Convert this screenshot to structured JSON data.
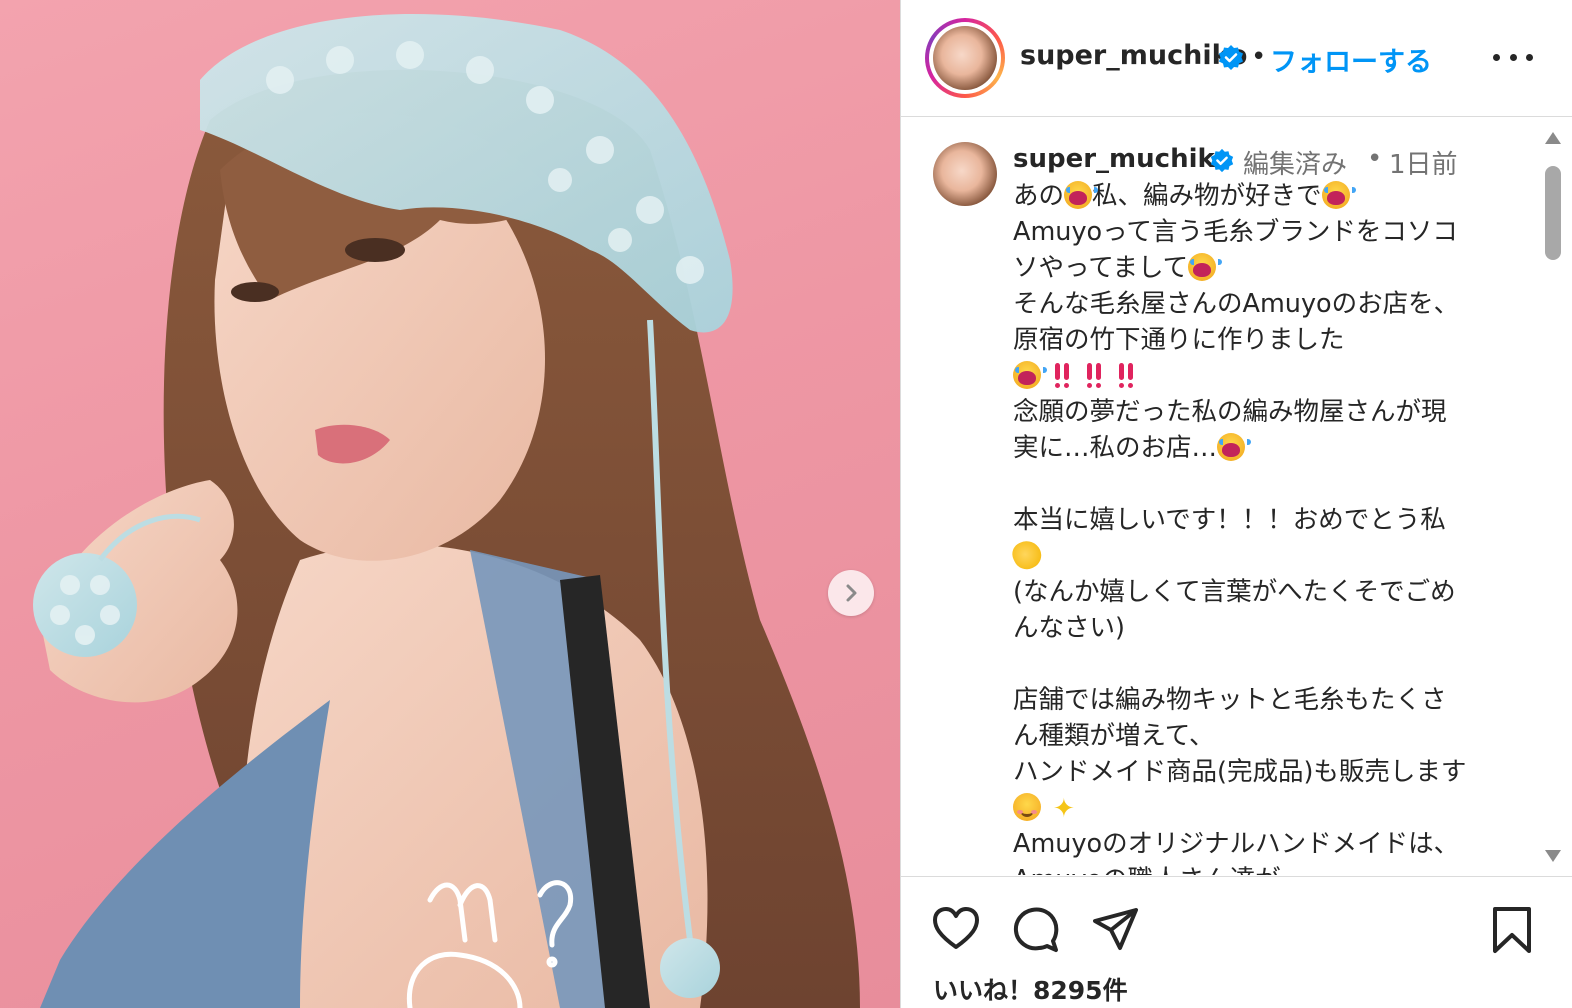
{
  "post": {
    "author": "super_muchiko",
    "follow_label": "フォローする",
    "header_separator": "•",
    "image_overlay_text": "m?"
  },
  "caption": {
    "author": "super_muchiko",
    "edited_label": "編集済み",
    "separator": "•",
    "time_ago": "1日前",
    "lines": [
      {
        "text": "あの",
        "e1": "cry",
        "t2": "私、編み物が好きで",
        "e2": "cry"
      },
      {
        "text": "Amuyoって言う毛糸ブランドをコソコ"
      },
      {
        "text": "ソやってまして",
        "e1": "cry"
      },
      {
        "text": "そんな毛糸屋さんのAmuyoのお店を、"
      },
      {
        "text": "原宿の竹下通りに作りました"
      },
      {
        "emoji_row": [
          "cry",
          "bang",
          "bang",
          "bang"
        ]
      },
      {
        "text": "念願の夢だった私の編み物屋さんが現"
      },
      {
        "text": "実に…私のお店…",
        "e1": "cry"
      },
      {
        "text": ""
      },
      {
        "text": "本当に嬉しいです！！！おめでとう私"
      },
      {
        "emoji_row": [
          "clap"
        ]
      },
      {
        "text": "(なんか嬉しくて言葉がへたくそでごめ"
      },
      {
        "text": "んなさい)"
      },
      {
        "text": ""
      },
      {
        "text": "店舗では編み物キットと毛糸もたくさ"
      },
      {
        "text": "ん種類が増えて、"
      },
      {
        "text": "ハンドメイド商品(完成品)も販売します"
      },
      {
        "emoji_row": [
          "smile",
          "sparkles"
        ]
      },
      {
        "text": "Amuyoのオリジナルハンドメイドは、"
      },
      {
        "text": "Amuyoの職人さん達が"
      }
    ]
  },
  "actions": {
    "like_icon": "heart-icon",
    "comment_icon": "comment-icon",
    "share_icon": "share-icon",
    "save_icon": "bookmark-icon"
  },
  "likes_text": "いいね！8295件",
  "colors": {
    "accent_blue": "#0095f6",
    "photo_bg": "#ee97a4",
    "verified": "#0095f6"
  }
}
